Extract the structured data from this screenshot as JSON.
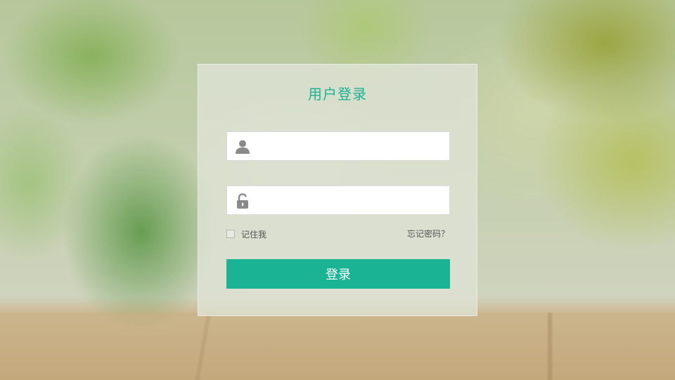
{
  "login": {
    "title": "用户登录",
    "username": {
      "value": "",
      "placeholder": "",
      "icon": "user-icon"
    },
    "password": {
      "value": "",
      "placeholder": "",
      "icon": "lock-icon"
    },
    "remember_label": "记住我",
    "remember_checked": false,
    "forgot_label": "忘记密码？",
    "submit_label": "登录"
  },
  "colors": {
    "accent": "#1ab394",
    "icon": "#8a8a8a",
    "panel": "#dee2d4"
  }
}
